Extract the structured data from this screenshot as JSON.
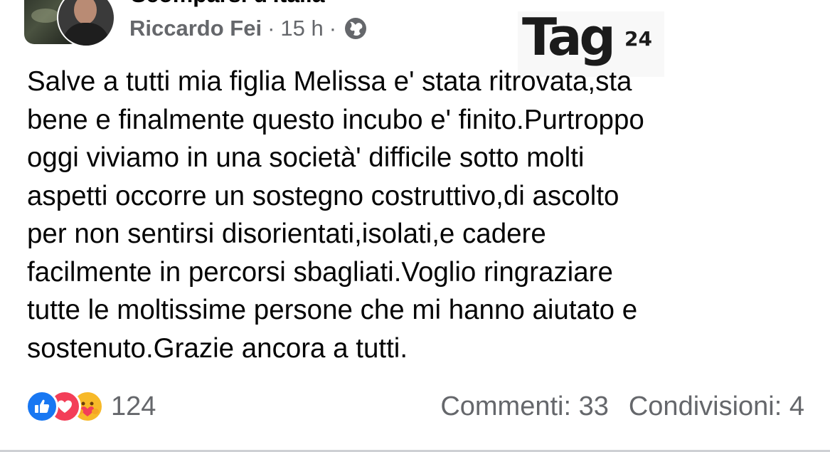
{
  "header": {
    "group_name": "Scomparsi d'Italia",
    "author": "Riccardo Fei",
    "separator": "·",
    "time": "15 h",
    "audience_icon": "globe-icon"
  },
  "watermark": {
    "logo_text": "Tag",
    "logo_number": "24"
  },
  "post": {
    "lines": [
      "Salve a tutti mia figlia Melissa e' stata ritrovata,sta",
      "bene e finalmente questo incubo e' finito.Purtroppo",
      "oggi viviamo in una società' difficile sotto molti",
      "aspetti occorre un sostegno costruttivo,di ascolto",
      "per non sentirsi disorientati,isolati,e cadere",
      "facilmente in percorsi sbagliati.Voglio ringraziare",
      "tutte le moltissime persone che mi hanno aiutato e",
      "sostenuto.Grazie ancora a tutti."
    ]
  },
  "footer": {
    "reaction_icons": [
      "like-icon",
      "love-icon",
      "care-icon"
    ],
    "reaction_count": "124",
    "comments": "Commenti: 33",
    "shares": "Condivisioni: 4"
  },
  "colors": {
    "text": "#050505",
    "secondary": "#65676b",
    "like": "#1877f2",
    "love": "#f33e58",
    "care": "#f7b928"
  }
}
